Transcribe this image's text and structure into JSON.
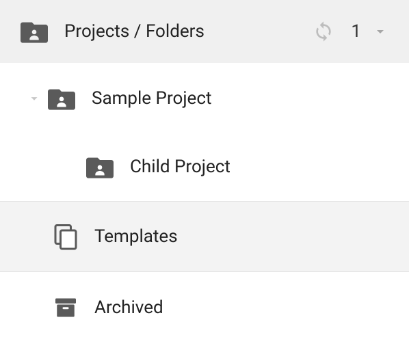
{
  "header": {
    "title": "Projects / Folders",
    "count": "1"
  },
  "tree": {
    "items": [
      {
        "label": "Sample Project",
        "icon": "folder-shared",
        "expanded": true,
        "indent": 0
      },
      {
        "label": "Child Project",
        "icon": "folder-shared",
        "expanded": false,
        "indent": 1
      }
    ]
  },
  "sections": [
    {
      "label": "Templates",
      "icon": "copy",
      "selected": true
    },
    {
      "label": "Archived",
      "icon": "archive",
      "selected": false
    }
  ]
}
